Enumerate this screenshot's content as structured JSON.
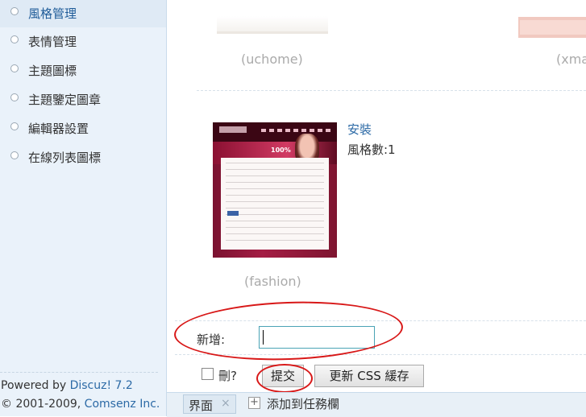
{
  "sidebar": {
    "items": [
      {
        "label": "風格管理",
        "active": true
      },
      {
        "label": "表情管理"
      },
      {
        "label": "主題圖標"
      },
      {
        "label": "主題鑒定圖章"
      },
      {
        "label": "編輯器設置"
      },
      {
        "label": "在線列表圖標"
      }
    ],
    "footer": {
      "powered_prefix": "Powered by ",
      "powered_link": "Discuz! 7.2",
      "copyright_prefix": "© 2001-2009, ",
      "copyright_link": "Comsenz Inc."
    }
  },
  "main": {
    "themes_top": [
      {
        "caption": "(uchome)"
      },
      {
        "caption": "(xma"
      }
    ],
    "theme": {
      "caption": "(fashion)",
      "install_label": "安裝",
      "style_count_label": "風格數:1",
      "thumb_text": "100%"
    },
    "form": {
      "new_label": "新增:",
      "new_value": "",
      "delete_label": "刪?",
      "submit_label": "提交",
      "update_css_label": "更新 CSS 緩存"
    },
    "taskbar": {
      "tab_label": "界面",
      "tab_close": "×",
      "add_icon": "+",
      "add_label": "添加到任務欄"
    }
  },
  "colors": {
    "sidebar_bg": "#eaf2fa",
    "link": "#2c6aa6",
    "annotation_red": "#d81818"
  }
}
